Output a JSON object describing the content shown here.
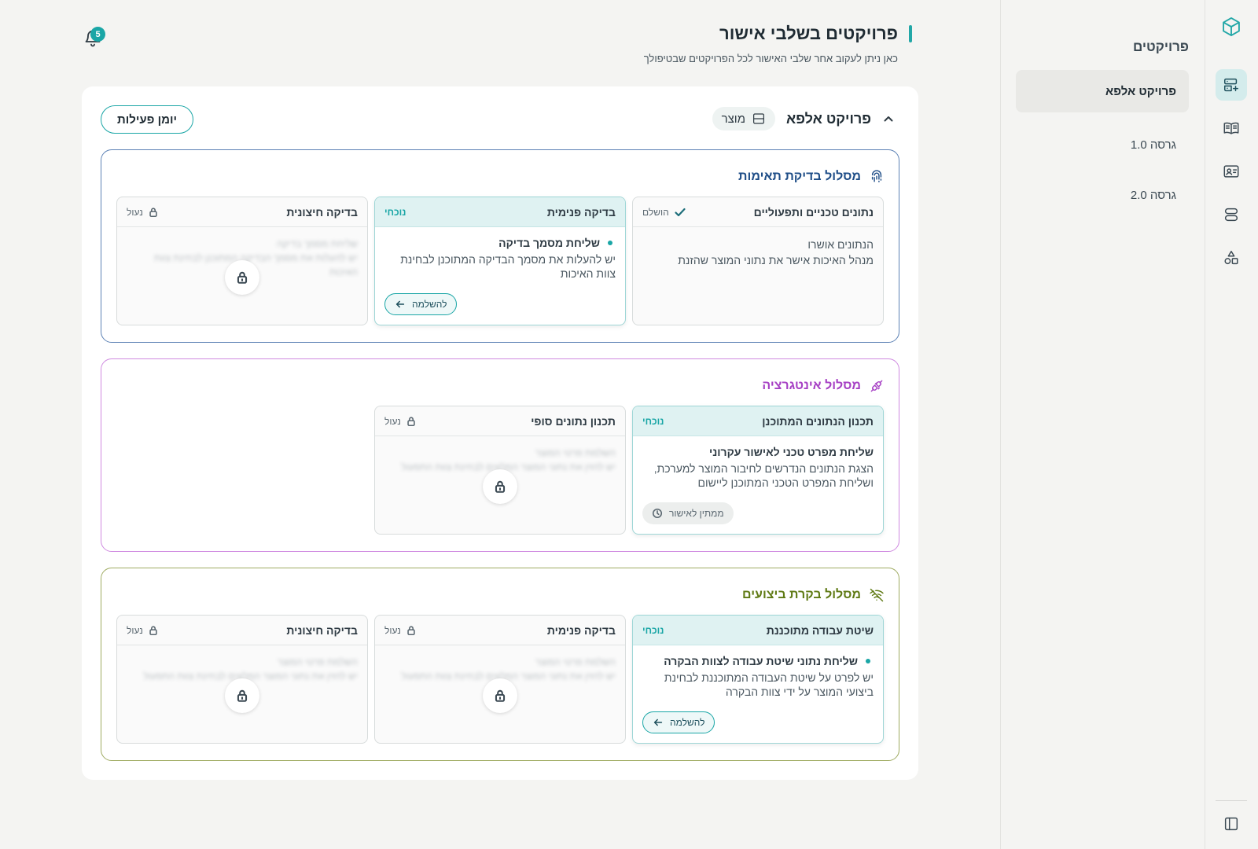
{
  "sidebar": {
    "title": "פרויקטים",
    "items": [
      {
        "label": "פרויקט אלפא",
        "active": true
      },
      {
        "label": "גרסה 1.0",
        "active": false
      },
      {
        "label": "גרסה 2.0",
        "active": false
      }
    ]
  },
  "rail": {
    "icons": [
      "cube-logo-icon",
      "server-plus-icon",
      "book-icon",
      "contact-card-icon",
      "database-icon",
      "shapes-icon",
      "sidebar-toggle-icon"
    ]
  },
  "header": {
    "title": "פרויקטים בשלבי אישור",
    "subtitle": "כאן ניתן לעקוב אחר שלבי האישור לכל הפרויקטים שבטיפולך",
    "notifications_count": "5"
  },
  "project": {
    "name": "פרויקט אלפא",
    "tag": "מוצר",
    "log_button": "יומן פעילות"
  },
  "labels": {
    "current": "נוכחי",
    "locked": "נעול",
    "completed": "הושלם",
    "continue": "להשלמה",
    "awaiting": "ממתין לאישור"
  },
  "tracks": [
    {
      "title": "מסלול בדיקת תאימות",
      "color": "#1e4d87",
      "stages": [
        {
          "name": "נתונים טכניים ותפעוליים",
          "state": "completed",
          "lines": [
            "הנתונים אושרו",
            "מנהל האיכות אישר את נתוני המוצר שהזנת"
          ]
        },
        {
          "name": "בדיקה פנימית",
          "state": "current",
          "task": "שליחת מסמך בדיקה",
          "desc": "יש להעלות את מסמך הבדיקה המתוכנן לבחינת צוות האיכות",
          "action": "continue"
        },
        {
          "name": "בדיקה חיצונית",
          "state": "locked",
          "blur": [
            "שליחת מסמך בדיקה",
            "יש להעלות את מסמך הבדיקה המתוכנן לבחינת צוות האיכות"
          ]
        }
      ]
    },
    {
      "title": "מסלול אינטגרציה",
      "color": "#a640c4",
      "stages": [
        {
          "name": "תכנון הנתונים המתוכנן",
          "state": "current",
          "task": "שליחת מפרט טכני לאישור עקרוני",
          "desc": "הצגת הנתונים הנדרשים לחיבור המוצר למערכת, ושליחת המפרט הטכני המתוכנן ליישום",
          "action": "awaiting"
        },
        {
          "name": "תכנון נתונים סופי",
          "state": "locked",
          "blur": [
            "השלמת פרטי המוצר",
            "יש להזין את נתוני המוצר המלאים לבחינת צוות התפעול"
          ]
        }
      ]
    },
    {
      "title": "מסלול בקרת ביצועים",
      "color": "#5f7a14",
      "stages": [
        {
          "name": "שיטת עבודה מתוכננת",
          "state": "current",
          "task": "שליחת נתוני שיטת עבודה לצוות הבקרה",
          "desc": "יש לפרט על שיטת העבודה המתוכננת לבחינת ביצועי המוצר על ידי צוות הבקרה",
          "action": "continue"
        },
        {
          "name": "בדיקה פנימית",
          "state": "locked",
          "blur": [
            "השלמת פרטי המוצר",
            "יש להזין את נתוני המוצר המלאים לבחינת צוות התפעול"
          ]
        },
        {
          "name": "בדיקה חיצונית",
          "state": "locked",
          "blur": [
            "השלמת פרטי המוצר",
            "יש להזין את נתוני המוצר המלאים לבחינת צוות התפעול"
          ]
        }
      ]
    }
  ]
}
